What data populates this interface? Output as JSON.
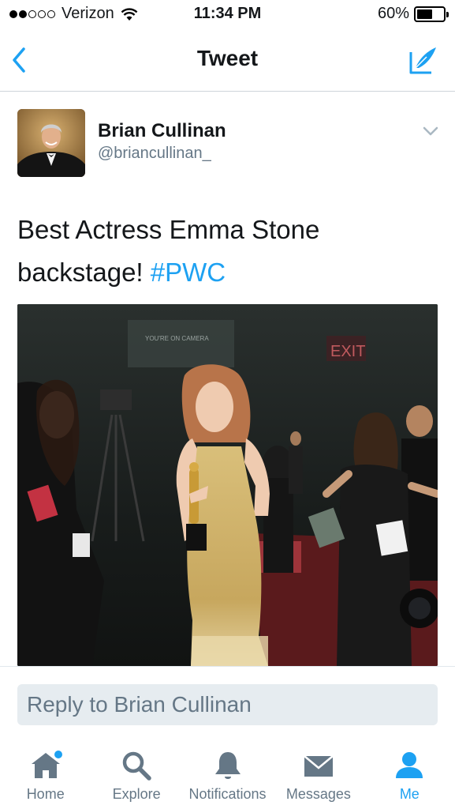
{
  "status_bar": {
    "carrier": "Verizon",
    "signal_bars_filled": 2,
    "signal_bars_total": 5,
    "time": "11:34 PM",
    "battery_percent_label": "60%",
    "battery_level": 0.6
  },
  "nav": {
    "title": "Tweet",
    "back_icon": "chevron-left-icon",
    "compose_icon": "compose-tweet-icon",
    "accent_color": "#1da1f2"
  },
  "tweet": {
    "author_name": "Brian Cullinan",
    "author_handle": "@briancullinan_",
    "text_main": "Best Actress Emma Stone backstage! ",
    "hashtag": "#PWC",
    "photo_sign_text": "EXIT",
    "photo_screen_text": "YOU'RE ON CAMERA"
  },
  "reply": {
    "placeholder": "Reply to Brian Cullinan"
  },
  "tab_bar": {
    "active_tab": "Me",
    "tabs": [
      {
        "label": "Home",
        "icon": "home-icon",
        "has_notification_dot": true
      },
      {
        "label": "Explore",
        "icon": "search-icon",
        "has_notification_dot": false
      },
      {
        "label": "Notifications",
        "icon": "bell-icon",
        "has_notification_dot": false
      },
      {
        "label": "Messages",
        "icon": "envelope-icon",
        "has_notification_dot": false
      },
      {
        "label": "Me",
        "icon": "person-icon",
        "has_notification_dot": false
      }
    ]
  }
}
